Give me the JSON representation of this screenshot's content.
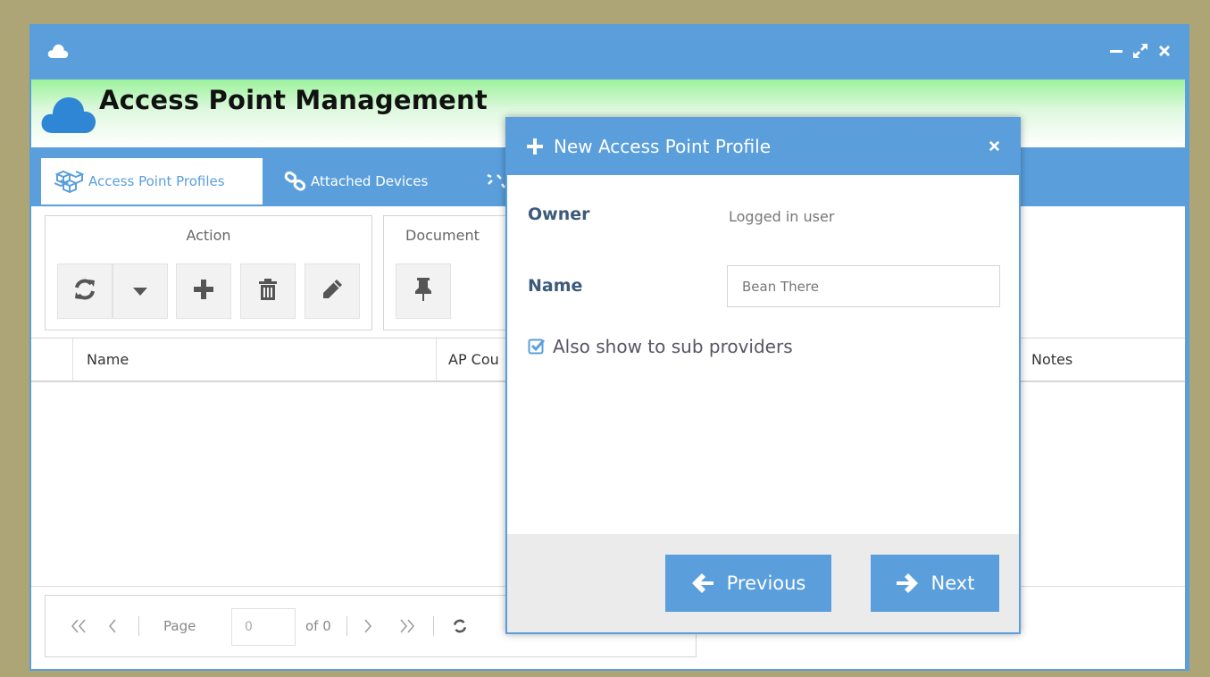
{
  "app": {
    "title": "Access Point Management"
  },
  "window_controls": {
    "minimize": "minimize-icon",
    "maximize": "expand-icon",
    "close": "close-icon"
  },
  "tabs": [
    {
      "label": "Access Point Profiles",
      "icon": "cubes-icon",
      "active": true
    },
    {
      "label": "Attached Devices",
      "icon": "link-icon",
      "active": false
    }
  ],
  "toolbar": {
    "action_label": "Action",
    "document_label": "Document",
    "buttons": [
      "refresh-icon",
      "caret-down-icon",
      "plus-icon",
      "trash-icon",
      "pencil-icon",
      "pin-icon"
    ]
  },
  "grid": {
    "columns": [
      "Name",
      "AP Cou",
      "Notes"
    ]
  },
  "pager": {
    "page_label": "Page",
    "page_value": "0",
    "of_label": "of 0"
  },
  "dialog": {
    "title": "New Access Point Profile",
    "owner_label": "Owner",
    "owner_value": "Logged in user",
    "name_label": "Name",
    "name_value": "Bean There",
    "checkbox_label": "Also show to sub providers",
    "checkbox_checked": true,
    "previous_label": "Previous",
    "next_label": "Next"
  },
  "colors": {
    "primary": "#5a9fdc",
    "background": "#aea576",
    "header_green": "#9cf29c",
    "label_blue": "#3c5a7a"
  }
}
